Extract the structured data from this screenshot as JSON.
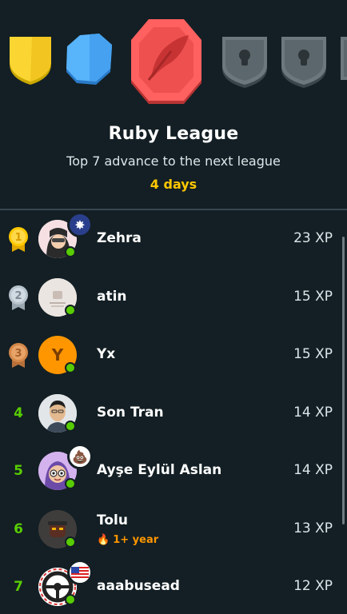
{
  "league": {
    "title": "Ruby League",
    "subtitle": "Top 7 advance to the next league",
    "time_left": "4 days"
  },
  "badges": [
    {
      "name": "gold",
      "color": "#f8d032",
      "state": "completed"
    },
    {
      "name": "sapphire",
      "color": "#4ea8f5",
      "state": "completed"
    },
    {
      "name": "ruby",
      "color": "#ee5555",
      "state": "current"
    },
    {
      "name": "locked",
      "color": "#4b4b4b",
      "state": "locked"
    },
    {
      "name": "locked",
      "color": "#4b4b4b",
      "state": "locked"
    },
    {
      "name": "locked",
      "color": "#4b4b4b",
      "state": "locked"
    }
  ],
  "leaderboard": [
    {
      "rank": "1",
      "medal": "gold",
      "name": "Zehra",
      "xp": "23 XP",
      "flair": "sparkle-icon"
    },
    {
      "rank": "2",
      "medal": "silver",
      "name": "atin",
      "xp": "15 XP"
    },
    {
      "rank": "3",
      "medal": "bronze",
      "name": "Yx",
      "avatar_letter": "Y",
      "xp": "15 XP"
    },
    {
      "rank": "4",
      "name": "Son Tran",
      "xp": "14 XP"
    },
    {
      "rank": "5",
      "name": "Ayşe Eylül Aslan",
      "xp": "14 XP",
      "flair": "poop-emoji-icon"
    },
    {
      "rank": "6",
      "name": "Tolu",
      "streak": "1+ year",
      "xp": "13 XP"
    },
    {
      "rank": "7",
      "name": "aaabusead",
      "xp": "12 XP",
      "flair": "us-flag-icon"
    }
  ],
  "colors": {
    "background": "#131f24",
    "accent_green": "#58cc02",
    "gold": "#ffc800",
    "streak_orange": "#ff9600"
  }
}
